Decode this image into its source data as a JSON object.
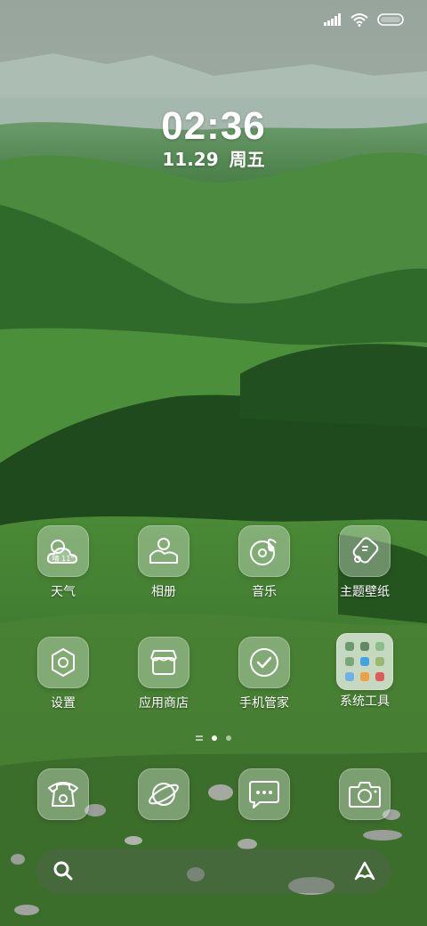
{
  "status_bar": {
    "icons": [
      "signal-icon",
      "wifi-icon",
      "battery-icon"
    ]
  },
  "clock": {
    "time": "02:36",
    "date": "11.29",
    "weekday": "周五"
  },
  "apps_row1": [
    {
      "label": "天气",
      "icon": "weather-icon",
      "temp": "晴 11°"
    },
    {
      "label": "相册",
      "icon": "gallery-icon"
    },
    {
      "label": "音乐",
      "icon": "music-icon"
    },
    {
      "label": "主题壁纸",
      "icon": "theme-icon"
    }
  ],
  "apps_row2": [
    {
      "label": "设置",
      "icon": "settings-icon"
    },
    {
      "label": "应用商店",
      "icon": "app-store-icon"
    },
    {
      "label": "手机管家",
      "icon": "security-icon"
    },
    {
      "label": "系统工具",
      "icon": "folder-icon"
    }
  ],
  "page_indicator": {
    "pages": 2,
    "current": 1
  },
  "dock": [
    {
      "icon": "phone-icon"
    },
    {
      "icon": "browser-icon"
    },
    {
      "icon": "messages-icon"
    },
    {
      "icon": "camera-icon"
    }
  ],
  "search_bar": {
    "icons": [
      "search-icon",
      "assistant-icon"
    ]
  },
  "colors": {
    "sky": "#9fb3a3",
    "hills": "#3f7a35",
    "dark_forest": "#1f4a1e",
    "icon_tint": "#e1f0e1"
  }
}
